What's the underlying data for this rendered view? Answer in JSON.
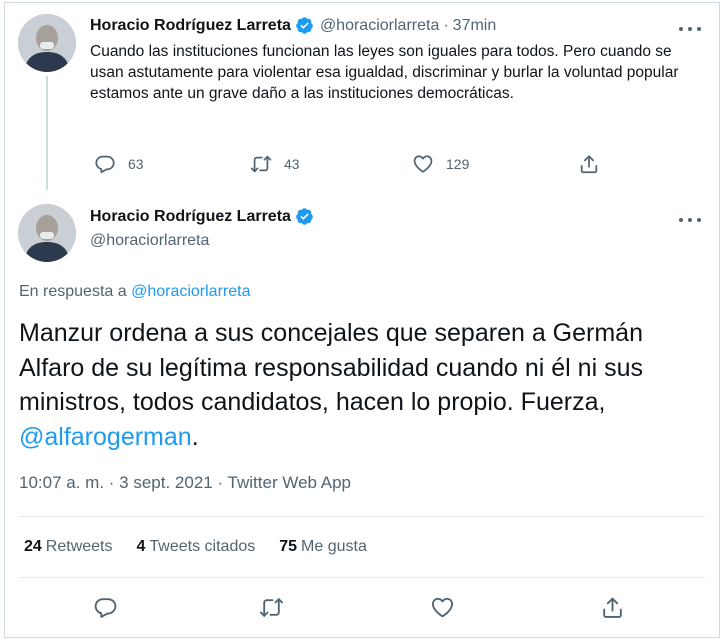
{
  "colors": {
    "text": "#0f1419",
    "secondary": "#536471",
    "link": "#1d9bf0",
    "verified": "#1d9bf0",
    "divider": "#e7ebee"
  },
  "parent_tweet": {
    "author_name": "Horacio Rodríguez Larreta",
    "handle": "@horaciorlarreta",
    "separator": "·",
    "time": "37min",
    "text": "Cuando las instituciones funcionan las leyes son iguales para todos. Pero cuando se usan astutamente para violentar esa igualdad, discriminar y burlar la voluntad popular estamos ante un grave daño a las instituciones democráticas.",
    "replies": "63",
    "retweets": "43",
    "likes": "129",
    "icons": [
      "comment-icon",
      "retweet-icon",
      "heart-icon",
      "share-icon",
      "more-icon",
      "verified-badge-icon"
    ]
  },
  "main_tweet": {
    "author_name": "Horacio Rodríguez Larreta",
    "handle": "@horaciorlarreta",
    "reply_prefix": "En respuesta a",
    "reply_to": "@horaciorlarreta",
    "text_before_mention": "Manzur ordena a sus concejales que separen a Germán Alfaro de su legítima responsabilidad cuando ni él ni sus ministros, todos candidatos, hacen lo propio. Fuerza, ",
    "mention": "@alfarogerman",
    "text_after_mention": ".",
    "timestamp": "10:07 a. m. · 3 sept. 2021 · ",
    "source": "Twitter Web App",
    "stats": {
      "retweets_count": "24",
      "retweets_label": "Retweets",
      "quotes_count": "4",
      "quotes_label": "Tweets citados",
      "likes_count": "75",
      "likes_label": "Me gusta"
    }
  }
}
